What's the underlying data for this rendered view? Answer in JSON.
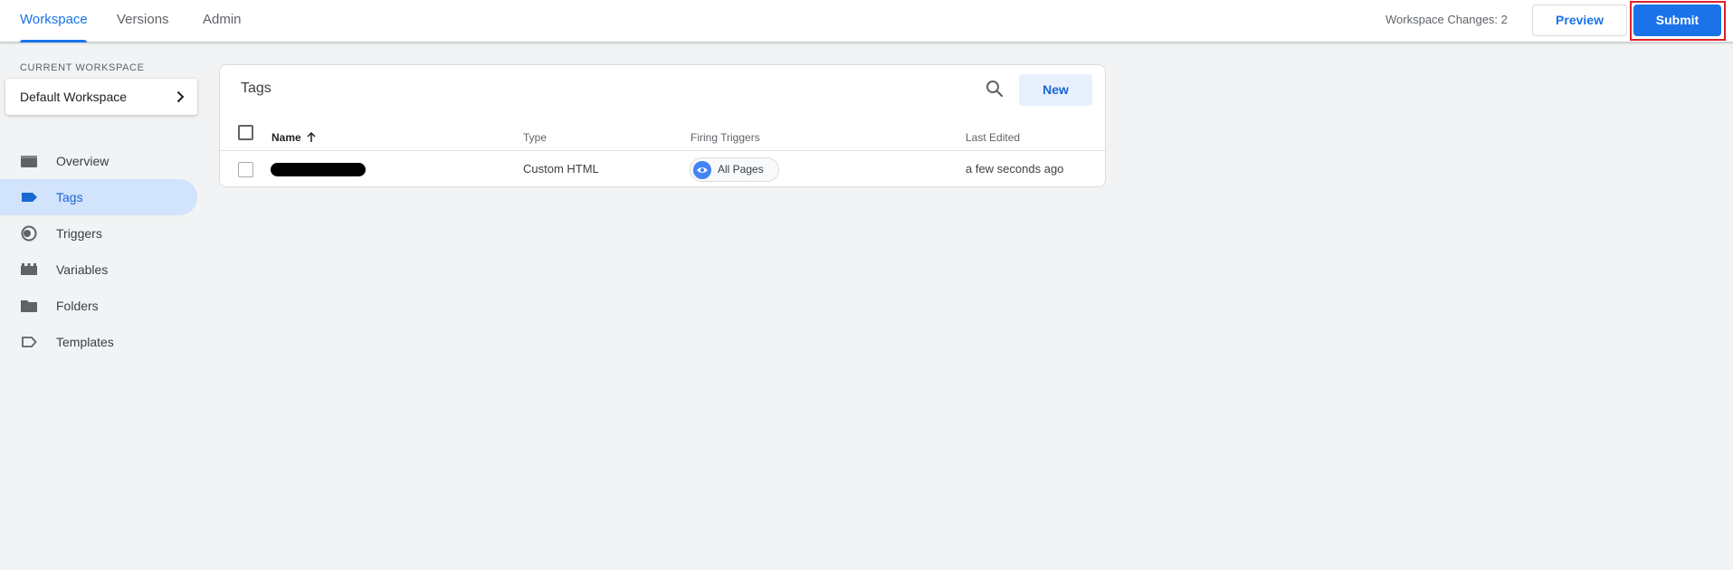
{
  "header": {
    "tabs": [
      {
        "label": "Workspace",
        "active": true
      },
      {
        "label": "Versions",
        "active": false
      },
      {
        "label": "Admin",
        "active": false
      }
    ],
    "workspace_changes": "Workspace Changes: 2",
    "preview_label": "Preview",
    "submit_label": "Submit"
  },
  "sidebar": {
    "current_workspace_label": "CURRENT WORKSPACE",
    "workspace_name": "Default Workspace",
    "items": [
      {
        "label": "Overview",
        "icon": "overview-icon",
        "active": false
      },
      {
        "label": "Tags",
        "icon": "tag-icon",
        "active": true
      },
      {
        "label": "Triggers",
        "icon": "trigger-icon",
        "active": false
      },
      {
        "label": "Variables",
        "icon": "variables-icon",
        "active": false
      },
      {
        "label": "Folders",
        "icon": "folder-icon",
        "active": false
      },
      {
        "label": "Templates",
        "icon": "template-icon",
        "active": false
      }
    ]
  },
  "main": {
    "title": "Tags",
    "new_label": "New",
    "columns": {
      "name": "Name",
      "type": "Type",
      "triggers": "Firing Triggers",
      "last_edited": "Last Edited"
    },
    "rows": [
      {
        "name": "",
        "name_redacted": true,
        "type": "Custom HTML",
        "trigger": "All Pages",
        "last_edited": "a few seconds ago"
      }
    ]
  },
  "colors": {
    "accent": "#1a73e8",
    "active_nav_bg": "#d2e3fc",
    "highlight_border": "#e0202a",
    "background": "#f1f3f4"
  }
}
